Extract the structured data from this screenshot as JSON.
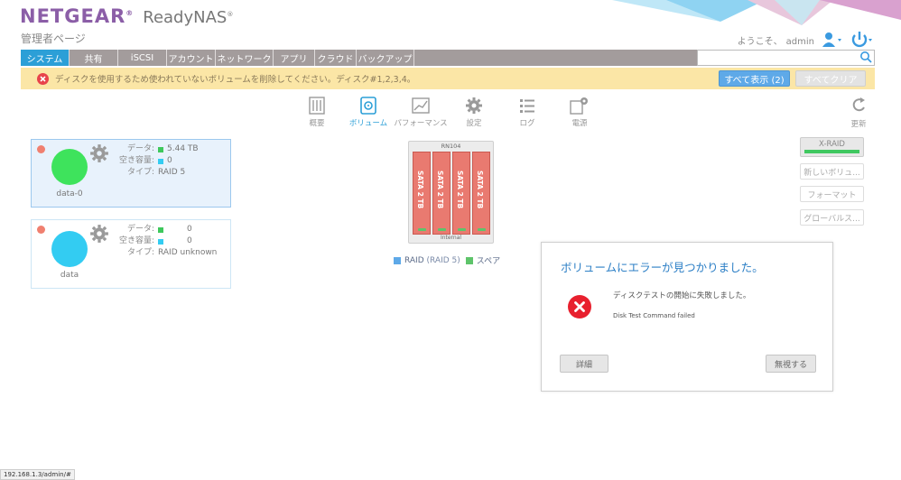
{
  "brand": {
    "logo": "NETGEAR",
    "product": "ReadyNAS",
    "admin_page": "管理者ページ"
  },
  "header": {
    "welcome": "ようこそ、",
    "user": "admin"
  },
  "nav": {
    "tabs": [
      {
        "label": "システム",
        "active": true
      },
      {
        "label": "共有"
      },
      {
        "label": "iSCSI"
      },
      {
        "label": "アカウント"
      },
      {
        "label": "ネットワーク"
      },
      {
        "label": "アプリ"
      },
      {
        "label": "クラウド"
      },
      {
        "label": "バックアップ"
      }
    ],
    "search": {
      "placeholder": "",
      "value": ""
    }
  },
  "alert": {
    "text": "ディスクを使用するため使われていないボリュームを削除してください。ディスク#1,2,3,4。",
    "show_all": "すべて表示 (2)",
    "clear_all": "すべてクリア"
  },
  "subnav": {
    "tabs": [
      {
        "label": "概要",
        "icon": "overview-icon"
      },
      {
        "label": "ボリューム",
        "icon": "volume-icon",
        "active": true
      },
      {
        "label": "パフォーマンス",
        "icon": "performance-icon"
      },
      {
        "label": "設定",
        "icon": "settings-icon"
      },
      {
        "label": "ログ",
        "icon": "log-icon"
      },
      {
        "label": "電源",
        "icon": "power-settings-icon"
      }
    ],
    "refresh": "更新"
  },
  "volumes": [
    {
      "name": "data-0",
      "status_color": "#f08070",
      "circle_color": "#3ee35c",
      "data_label": "データ:",
      "data_value": "5.44 TB",
      "free_label": "空き容量:",
      "free_value": "0",
      "type_label": "タイプ:",
      "type_value": "RAID 5",
      "selected": true
    },
    {
      "name": "data",
      "status_color": "#f08070",
      "circle_color": "#33ccf2",
      "data_label": "データ:",
      "data_value": "0",
      "free_label": "空き容量:",
      "free_value": "0",
      "type_label": "タイプ:",
      "type_value": "RAID unknown",
      "selected": false
    }
  ],
  "nas": {
    "model": "RN104",
    "location": "Internal",
    "bays": [
      "SATA 2 TB",
      "SATA 2 TB",
      "SATA 2 TB",
      "SATA 2 TB"
    ]
  },
  "legend": {
    "raid": "RAID",
    "raid_detail": "(RAID 5)",
    "spare": "スペア"
  },
  "side_buttons": {
    "raid": "X-RAID",
    "new_volume": "新しいボリュ...",
    "format": "フォーマット",
    "global_spare": "グローバルス..."
  },
  "dialog": {
    "title": "ボリュームにエラーが見つかりました。",
    "message": "ディスクテストの開始に失敗しました。",
    "detail": "Disk Test Command failed",
    "details_button": "詳細",
    "ignore_button": "無視する"
  },
  "statusbar": {
    "url": "192.168.1.3/admin/#"
  },
  "colors": {
    "accent": "#2c9fd7",
    "nav_bg": "#a39c9c",
    "alert_bg": "#fbe6a6",
    "brand": "#8b5ea7"
  }
}
